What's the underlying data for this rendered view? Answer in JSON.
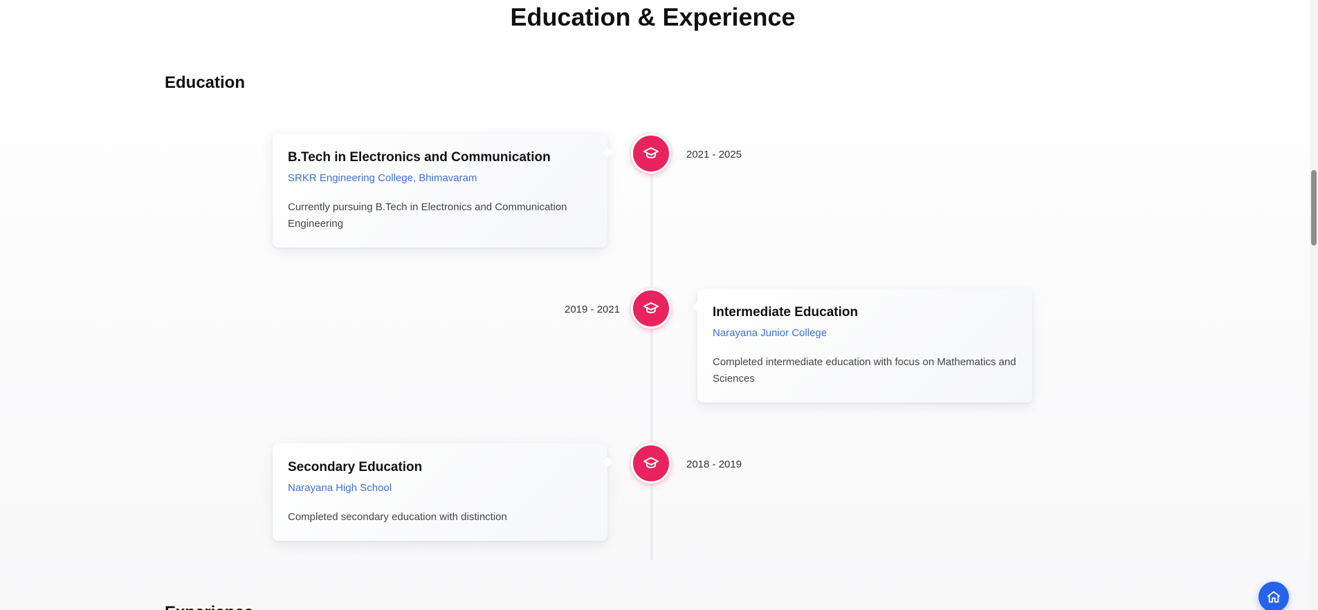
{
  "page": {
    "title": "Education & Experience"
  },
  "sections": {
    "education": {
      "title": "Education"
    },
    "experience": {
      "title": "Experience"
    }
  },
  "education": [
    {
      "title": "B.Tech in Electronics and Communication",
      "institution": "SRKR Engineering College, Bhimavaram",
      "description": "Currently pursuing B.Tech in Electronics and Communication Engineering",
      "period": "2021 - 2025",
      "icon": "graduation-cap-icon"
    },
    {
      "title": "Intermediate Education",
      "institution": "Narayana Junior College",
      "description": "Completed intermediate education with focus on Mathematics and Sciences",
      "period": "2019 - 2021",
      "icon": "graduation-cap-icon"
    },
    {
      "title": "Secondary Education",
      "institution": "Narayana High School",
      "description": "Completed secondary education with distinction",
      "period": "2018 - 2019",
      "icon": "graduation-cap-icon"
    }
  ],
  "floating_button": {
    "icon": "home-icon"
  },
  "colors": {
    "accent": "#e8235f",
    "link": "#3f6ed8",
    "home_button": "#2563eb"
  }
}
